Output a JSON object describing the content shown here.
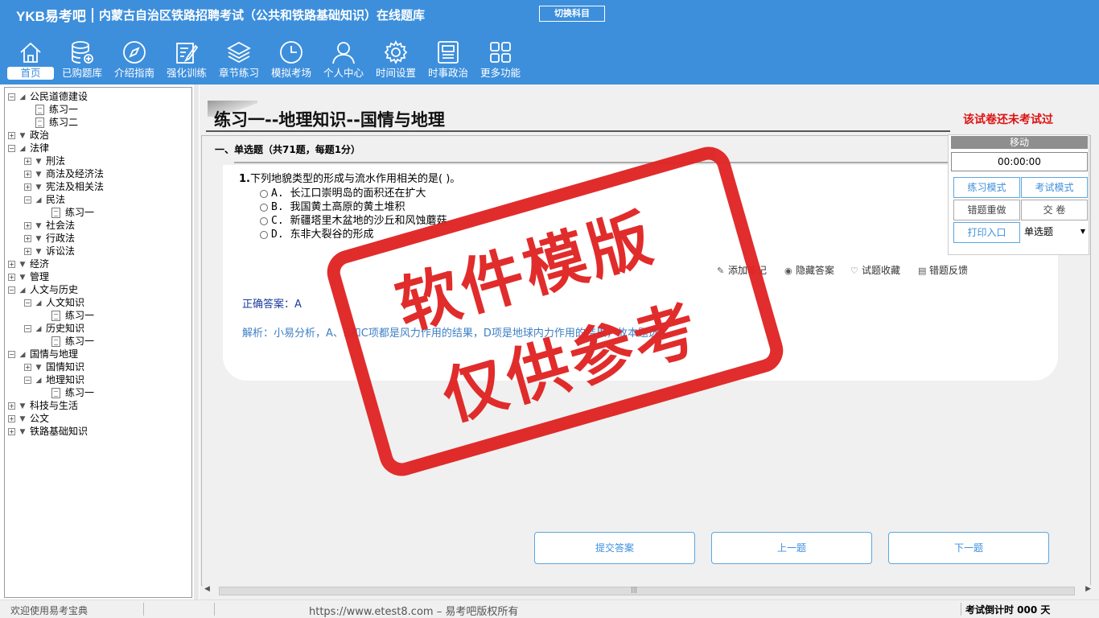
{
  "header": {
    "logo": "YKB易考吧",
    "title": "内蒙古自治区铁路招聘考试（公共和铁路基础知识）在线题库",
    "switch_label": "切换科目"
  },
  "nav": [
    {
      "label": "首页",
      "icon": "home-icon"
    },
    {
      "label": "已购题库",
      "icon": "database-icon"
    },
    {
      "label": "介绍指南",
      "icon": "compass-icon"
    },
    {
      "label": "强化训练",
      "icon": "edit-icon"
    },
    {
      "label": "章节练习",
      "icon": "layers-icon"
    },
    {
      "label": "模拟考场",
      "icon": "clock-icon"
    },
    {
      "label": "个人中心",
      "icon": "user-icon"
    },
    {
      "label": "时间设置",
      "icon": "gear-icon"
    },
    {
      "label": "时事政治",
      "icon": "news-icon"
    },
    {
      "label": "更多功能",
      "icon": "grid-icon"
    }
  ],
  "tree": [
    {
      "label": "公民道德建设",
      "level": 0,
      "kind": "open"
    },
    {
      "label": "练习一",
      "level": 1,
      "kind": "doc"
    },
    {
      "label": "练习二",
      "level": 1,
      "kind": "doc"
    },
    {
      "label": "政治",
      "level": 0,
      "kind": "closed"
    },
    {
      "label": "法律",
      "level": 0,
      "kind": "open"
    },
    {
      "label": "刑法",
      "level": 1,
      "kind": "closed"
    },
    {
      "label": "商法及经济法",
      "level": 1,
      "kind": "closed"
    },
    {
      "label": "宪法及相关法",
      "level": 1,
      "kind": "closed"
    },
    {
      "label": "民法",
      "level": 1,
      "kind": "open"
    },
    {
      "label": "练习一",
      "level": 2,
      "kind": "doc"
    },
    {
      "label": "社会法",
      "level": 1,
      "kind": "closed"
    },
    {
      "label": "行政法",
      "level": 1,
      "kind": "closed"
    },
    {
      "label": "诉讼法",
      "level": 1,
      "kind": "closed"
    },
    {
      "label": "经济",
      "level": 0,
      "kind": "closed"
    },
    {
      "label": "管理",
      "level": 0,
      "kind": "closed"
    },
    {
      "label": "人文与历史",
      "level": 0,
      "kind": "open"
    },
    {
      "label": "人文知识",
      "level": 1,
      "kind": "open"
    },
    {
      "label": "练习一",
      "level": 2,
      "kind": "doc"
    },
    {
      "label": "历史知识",
      "level": 1,
      "kind": "open"
    },
    {
      "label": "练习一",
      "level": 2,
      "kind": "doc"
    },
    {
      "label": "国情与地理",
      "level": 0,
      "kind": "open"
    },
    {
      "label": "国情知识",
      "level": 1,
      "kind": "closed"
    },
    {
      "label": "地理知识",
      "level": 1,
      "kind": "open"
    },
    {
      "label": "练习一",
      "level": 2,
      "kind": "doc"
    },
    {
      "label": "科技与生活",
      "level": 0,
      "kind": "closed"
    },
    {
      "label": "公文",
      "level": 0,
      "kind": "closed"
    },
    {
      "label": "铁路基础知识",
      "level": 0,
      "kind": "closed"
    }
  ],
  "paper": {
    "title": "练习一--地理知识--国情与地理",
    "status": "该试卷还未考试过",
    "section": "一、单选题（共71题，每题1分）"
  },
  "question": {
    "number": "1.",
    "text": "下列地貌类型的形成与流水作用相关的是( )。",
    "options": [
      "A. 长江口崇明岛的面积还在扩大",
      "B. 我国黄土高原的黄土堆积",
      "C. 新疆塔里木盆地的沙丘和风蚀蘑菇",
      "D. 东非大裂谷的形成"
    ],
    "tools": {
      "note": "添加笔记",
      "hide": "隐藏答案",
      "favorite": "试题收藏",
      "feedback": "错题反馈"
    },
    "answer": "正确答案：A",
    "analysis": "解析：小易分析，A、B和C项都是风力作用的结果，D项是地球内力作用的结果，故本题选A。"
  },
  "buttons": {
    "submit": "提交答案",
    "prev": "上一题",
    "next": "下一题"
  },
  "rpanel": {
    "head": "移动",
    "timer": "00:00:00",
    "practice": "练习模式",
    "exam": "考试模式",
    "redo": "错题重做",
    "hand_in": "交  卷",
    "print": "打印入口",
    "qtype": "单选题"
  },
  "footer": {
    "welcome": "欢迎使用易考宝典",
    "copyright": "https://www.etest8.com – 易考吧版权所有",
    "countdown": "考试倒计时 000 天"
  },
  "stamp": {
    "line1": "软件模版",
    "line2": "仅供参考"
  },
  "colors": {
    "header": "#3d8fdc",
    "stamp": "#e02424",
    "status": "#dd1111"
  }
}
